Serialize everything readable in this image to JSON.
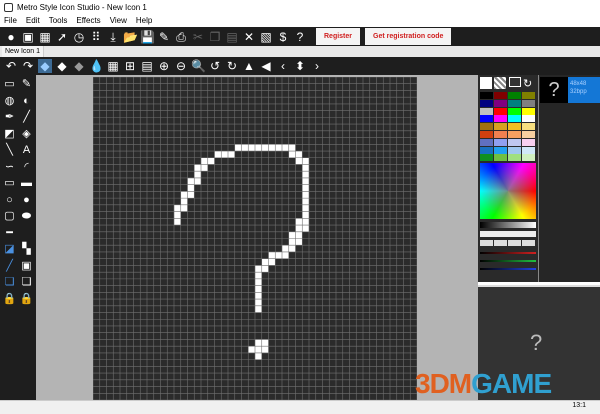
{
  "window": {
    "title": "Metro Style Icon Studio - New Icon 1"
  },
  "menu": [
    "File",
    "Edit",
    "Tools",
    "Effects",
    "View",
    "Help"
  ],
  "toolbar": {
    "icons": [
      {
        "name": "new-icon",
        "g": "●",
        "dis": false
      },
      {
        "name": "new-from-image",
        "g": "▣",
        "dis": false
      },
      {
        "name": "new-library",
        "g": "▦",
        "dis": false
      },
      {
        "name": "new-cursor",
        "g": "➚",
        "dis": false
      },
      {
        "name": "new-animated-cursor",
        "g": "◷",
        "dis": false
      },
      {
        "name": "new-multi",
        "g": "⠿",
        "dis": false
      },
      {
        "name": "import",
        "g": "⤓",
        "dis": false
      },
      {
        "name": "open",
        "g": "📂",
        "dis": false
      },
      {
        "name": "save",
        "g": "💾",
        "dis": false
      },
      {
        "name": "edit",
        "g": "✎",
        "dis": false
      },
      {
        "name": "print",
        "g": "⎙",
        "dis": false
      },
      {
        "name": "cut",
        "g": "✂",
        "dis": true
      },
      {
        "name": "copy",
        "g": "❐",
        "dis": true
      },
      {
        "name": "paste",
        "g": "▤",
        "dis": true
      },
      {
        "name": "delete",
        "g": "✕",
        "dis": false
      },
      {
        "name": "properties",
        "g": "▧",
        "dis": false
      },
      {
        "name": "register-key",
        "g": "$",
        "dis": false
      },
      {
        "name": "help",
        "g": "?",
        "dis": false
      }
    ],
    "register": "Register",
    "get_code": "Get registration code"
  },
  "tab": "New Icon 1",
  "toolbar2": [
    {
      "name": "undo",
      "g": "↶"
    },
    {
      "name": "redo",
      "g": "↷"
    },
    {
      "name": "view-3d-blue",
      "g": "◆"
    },
    {
      "name": "view-3d-white",
      "g": "◆"
    },
    {
      "name": "view-3d-gray",
      "g": "◆"
    },
    {
      "name": "transparency",
      "g": "💧"
    },
    {
      "name": "grid-fine",
      "g": "▦"
    },
    {
      "name": "grid-medium",
      "g": "⊞"
    },
    {
      "name": "grid-coarse",
      "g": "▤"
    },
    {
      "name": "zoom-in",
      "g": "⊕"
    },
    {
      "name": "zoom-out",
      "g": "⊖"
    },
    {
      "name": "zoom-actual",
      "g": "🔍"
    },
    {
      "name": "rotate-left",
      "g": "↺"
    },
    {
      "name": "rotate-right",
      "g": "↻"
    },
    {
      "name": "flip-horizontal",
      "g": "▲"
    },
    {
      "name": "flip-vertical",
      "g": "◀"
    },
    {
      "name": "shift-left",
      "g": "‹"
    },
    {
      "name": "shift-updown",
      "g": "⬍"
    },
    {
      "name": "shift-right",
      "g": "›"
    }
  ],
  "tools": [
    {
      "name": "rect-select",
      "g": "▭"
    },
    {
      "name": "color-picker",
      "g": "✎"
    },
    {
      "name": "eraser-color",
      "g": "◍"
    },
    {
      "name": "eraser",
      "g": "◐"
    },
    {
      "name": "pen",
      "g": "✒"
    },
    {
      "name": "brush",
      "g": "╱"
    },
    {
      "name": "fill",
      "g": "◩"
    },
    {
      "name": "replace-color",
      "g": "◈"
    },
    {
      "name": "line",
      "g": "╲"
    },
    {
      "name": "text",
      "g": "A"
    },
    {
      "name": "curve",
      "g": "∽"
    },
    {
      "name": "arc",
      "g": "◜"
    },
    {
      "name": "rectangle",
      "g": "▭"
    },
    {
      "name": "filled-rectangle",
      "g": "▬"
    },
    {
      "name": "ellipse",
      "g": "○"
    },
    {
      "name": "filled-ellipse",
      "g": "●"
    },
    {
      "name": "rounded-rect",
      "g": "▢"
    },
    {
      "name": "filled-rounded-rect",
      "g": "⬬"
    },
    {
      "name": "line-width",
      "g": "━"
    },
    {
      "name": "blank",
      "g": ""
    },
    {
      "name": "gradient",
      "g": "◪"
    },
    {
      "name": "pattern",
      "g": "▚"
    },
    {
      "name": "airbrush",
      "g": "╱"
    },
    {
      "name": "blur",
      "g": "▣"
    },
    {
      "name": "layers-blue",
      "g": "❏"
    },
    {
      "name": "layers-gray",
      "g": "❏"
    },
    {
      "name": "lock-image",
      "g": "🔒"
    },
    {
      "name": "lock-pattern",
      "g": "🔒"
    }
  ],
  "icon_pixels": [
    [
      21,
      10
    ],
    [
      22,
      10
    ],
    [
      23,
      10
    ],
    [
      24,
      10
    ],
    [
      25,
      10
    ],
    [
      26,
      10
    ],
    [
      27,
      10
    ],
    [
      28,
      10
    ],
    [
      29,
      10
    ],
    [
      18,
      11
    ],
    [
      19,
      11
    ],
    [
      20,
      11
    ],
    [
      29,
      11
    ],
    [
      30,
      11
    ],
    [
      16,
      12
    ],
    [
      17,
      12
    ],
    [
      30,
      12
    ],
    [
      31,
      12
    ],
    [
      15,
      13
    ],
    [
      16,
      13
    ],
    [
      31,
      13
    ],
    [
      15,
      14
    ],
    [
      31,
      14
    ],
    [
      14,
      15
    ],
    [
      15,
      15
    ],
    [
      31,
      15
    ],
    [
      14,
      16
    ],
    [
      31,
      16
    ],
    [
      13,
      17
    ],
    [
      14,
      17
    ],
    [
      31,
      17
    ],
    [
      13,
      18
    ],
    [
      31,
      18
    ],
    [
      12,
      19
    ],
    [
      13,
      19
    ],
    [
      31,
      19
    ],
    [
      12,
      20
    ],
    [
      31,
      20
    ],
    [
      12,
      21
    ],
    [
      30,
      21
    ],
    [
      31,
      21
    ],
    [
      30,
      22
    ],
    [
      31,
      22
    ],
    [
      29,
      23
    ],
    [
      30,
      23
    ],
    [
      29,
      24
    ],
    [
      30,
      24
    ],
    [
      28,
      25
    ],
    [
      29,
      25
    ],
    [
      26,
      26
    ],
    [
      27,
      26
    ],
    [
      28,
      26
    ],
    [
      25,
      27
    ],
    [
      26,
      27
    ],
    [
      24,
      28
    ],
    [
      25,
      28
    ],
    [
      24,
      29
    ],
    [
      24,
      30
    ],
    [
      24,
      31
    ],
    [
      24,
      32
    ],
    [
      24,
      33
    ],
    [
      24,
      34
    ],
    [
      24,
      39
    ],
    [
      25,
      39
    ],
    [
      23,
      40
    ],
    [
      24,
      40
    ],
    [
      25,
      40
    ],
    [
      24,
      41
    ]
  ],
  "icon_size": 48,
  "palette": [
    "#000000",
    "#800000",
    "#008000",
    "#808000",
    "#000080",
    "#800080",
    "#008080",
    "#808080",
    "#c0c0c0",
    "#ff0000",
    "#00ff00",
    "#ffff00",
    "#0000ff",
    "#ff00ff",
    "#00ffff",
    "#ffffff",
    "#a07010",
    "#d8a020",
    "#f0c020",
    "#f8e080",
    "#d04010",
    "#f08050",
    "#f8a060",
    "#f8d0a0",
    "#6070c0",
    "#90a0f0",
    "#c0c8f0",
    "#f8d0f0",
    "#1870c0",
    "#20a0f0",
    "#a0c8f0",
    "#d0e8f8",
    "#109020",
    "#70c040",
    "#a0e080",
    "#d0f0c0"
  ],
  "preview": {
    "thumb_glyph": "?",
    "size": "48x48",
    "depth": "32bpp",
    "big_glyph": "?"
  },
  "status": {
    "zoom": "13:1"
  },
  "watermark": "3DMGAME"
}
